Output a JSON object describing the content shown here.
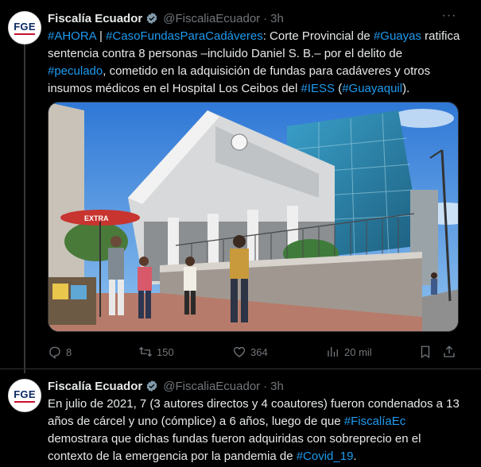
{
  "tweets": [
    {
      "author": "Fiscalía Ecuador",
      "handle": "@FiscaliaEcuador",
      "time": "3h",
      "avatar_text": "FGE",
      "text_parts": [
        {
          "t": "#AHORA",
          "h": true
        },
        {
          "t": " | ",
          "h": false
        },
        {
          "t": "#CasoFundasParaCadáveres",
          "h": true
        },
        {
          "t": ": Corte Provincial de ",
          "h": false
        },
        {
          "t": "#Guayas",
          "h": true
        },
        {
          "t": " ratifica sentencia contra 8 personas –incluido Daniel S. B.– por el delito de ",
          "h": false
        },
        {
          "t": "#peculado",
          "h": true
        },
        {
          "t": ", cometido en la adquisición de fundas para cadáveres y otros insumos médicos en el Hospital Los Ceibos del ",
          "h": false
        },
        {
          "t": "#IESS",
          "h": true
        },
        {
          "t": " (",
          "h": false
        },
        {
          "t": "#Guayaquil",
          "h": true
        },
        {
          "t": ").",
          "h": false
        }
      ],
      "media": {
        "sign_text": "EXTRA"
      },
      "actions": {
        "replies": "8",
        "retweets": "150",
        "likes": "364",
        "views": "20 mil"
      }
    },
    {
      "author": "Fiscalía Ecuador",
      "handle": "@FiscaliaEcuador",
      "time": "3h",
      "avatar_text": "FGE",
      "text_parts": [
        {
          "t": "En julio de 2021, 7 (3 autores directos y 4 coautores) fueron condenados a 13 años de cárcel y uno (cómplice) a 6 años, luego de que ",
          "h": false
        },
        {
          "t": "#FiscalíaEc",
          "h": true
        },
        {
          "t": " demostrara que dichas fundas fueron adquiridas con sobreprecio en el contexto de la emergencia por la pandemia de ",
          "h": false
        },
        {
          "t": "#Covid_19",
          "h": true
        },
        {
          "t": ".",
          "h": false
        }
      ]
    }
  ],
  "colors": {
    "background": "#000000",
    "text": "#e7e9ea",
    "muted": "#71767b",
    "link": "#1d9bf0",
    "verified_badge": "#829aab"
  }
}
